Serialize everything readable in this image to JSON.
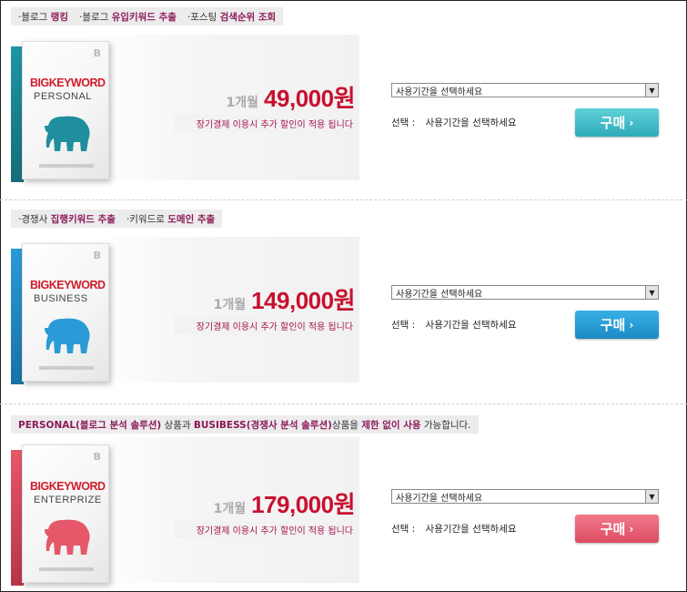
{
  "products": [
    {
      "tags": [
        {
          "prefix": "·블로그 ",
          "highlight": "랭킹"
        },
        {
          "prefix": "·블로그 ",
          "highlight": "유입키워드 추출"
        },
        {
          "prefix": "·포스팅 ",
          "highlight": "검색순위 조회"
        }
      ],
      "box": {
        "letter": "B",
        "brand": "BIGKEYWORD",
        "edition": "PERSONAL",
        "color": "#1f8f9d"
      },
      "period": "1개월",
      "price": "49,000원",
      "discount": "장기결제 이용시 추가 할인이 적용 됩니다",
      "select_value": "사용기간을 선택하세요",
      "selection_label": "선택 :",
      "selection_value": "사용기간을 선택하세요",
      "buy_label": "구매",
      "buy_icon": "chevron-right-icon"
    },
    {
      "tags": [
        {
          "prefix": "·경쟁사 ",
          "highlight": "집행키워드 추출"
        },
        {
          "prefix": "·키워드로 ",
          "highlight": "도메인 추출"
        }
      ],
      "box": {
        "letter": "B",
        "brand": "BIGKEYWORD",
        "edition": "BUSINESS",
        "color": "#2a9bd6"
      },
      "period": "1개월",
      "price": "149,000원",
      "discount": "장기결제 이용시 추가 할인이 적용 됩니다",
      "select_value": "사용기간을 선택하세요",
      "selection_label": "선택 :",
      "selection_value": "사용기간을 선택하세요",
      "buy_label": "구매",
      "buy_icon": "chevron-right-icon"
    },
    {
      "note": {
        "p1": "PERSONAL(블로그 분석 솔루션)",
        "t1": " 상품과 ",
        "p2": "BUSIBESS(경쟁사 분석 솔루션)",
        "t2": "상품을 ",
        "p3": "제한 없이 사용",
        "t3": " 가능합니다."
      },
      "box": {
        "letter": "B",
        "brand": "BIGKEYWORD",
        "edition": "ENTERPRIZE",
        "color": "#e5586a"
      },
      "period": "1개월",
      "price": "179,000원",
      "discount": "장기결제 이용시 추가 할인이 적용 됩니다",
      "select_value": "사용기간을 선택하세요",
      "selection_label": "선택 :",
      "selection_value": "사용기간을 선택하세요",
      "buy_label": "구매",
      "buy_icon": "chevron-right-icon"
    }
  ]
}
